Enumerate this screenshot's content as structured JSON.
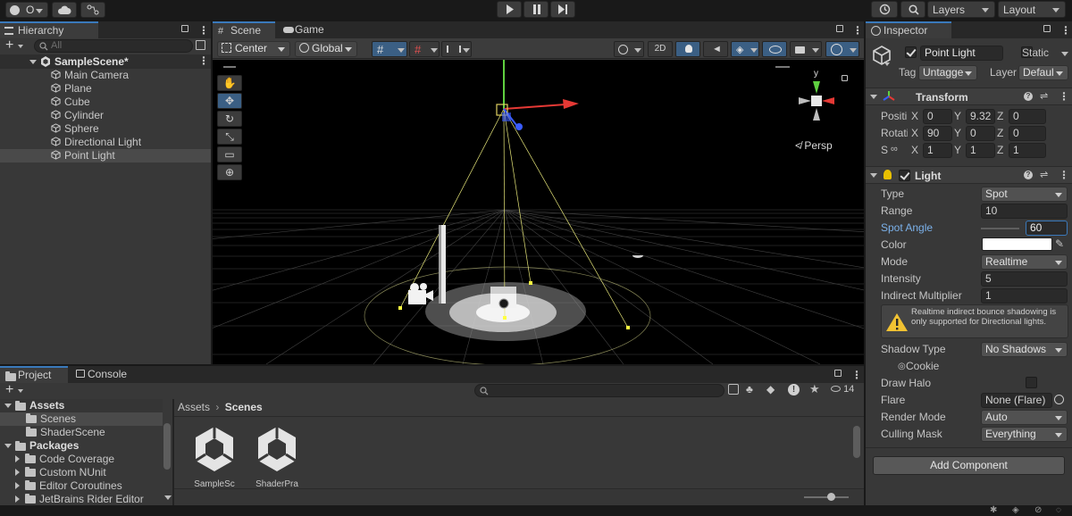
{
  "toolbar": {
    "account_label": "O",
    "layers_label": "Layers",
    "layout_label": "Layout"
  },
  "hierarchy": {
    "tab_label": "Hierarchy",
    "search_placeholder": "All",
    "scene_name": "SampleScene*",
    "items": [
      {
        "label": "Main Camera"
      },
      {
        "label": "Plane"
      },
      {
        "label": "Cube"
      },
      {
        "label": "Cylinder"
      },
      {
        "label": "Sphere"
      },
      {
        "label": "Directional Light"
      },
      {
        "label": "Point Light"
      }
    ]
  },
  "scene_view": {
    "tabs": [
      {
        "label": "Scene"
      },
      {
        "label": "Game"
      }
    ],
    "pivot_label": "Center",
    "space_label": "Global",
    "mode_2d_label": "2D",
    "gizmo_y_label": "y",
    "persp_label": "Persp"
  },
  "project": {
    "tabs": [
      {
        "label": "Project"
      },
      {
        "label": "Console"
      }
    ],
    "hidden_count": "14",
    "tree": {
      "assets_label": "Assets",
      "assets_children": [
        {
          "label": "Scenes"
        },
        {
          "label": "ShaderScene"
        }
      ],
      "packages_label": "Packages",
      "packages_children": [
        {
          "label": "Code Coverage"
        },
        {
          "label": "Custom NUnit"
        },
        {
          "label": "Editor Coroutines"
        },
        {
          "label": "JetBrains Rider Editor"
        }
      ]
    },
    "breadcrumb": {
      "root": "Assets",
      "current": "Scenes"
    },
    "files": [
      {
        "label": "SampleSc"
      },
      {
        "label": "ShaderPra"
      }
    ]
  },
  "inspector": {
    "tab_label": "Inspector",
    "object_name": "Point Light",
    "static_label": "Static",
    "tag_label": "Tag",
    "tag_value": "Untagge",
    "layer_label": "Layer",
    "layer_value": "Defaul",
    "transform": {
      "title": "Transform",
      "position_label": "Positi",
      "rotation_label": "Rotati",
      "scale_label": "S",
      "axis_x": "X",
      "axis_y": "Y",
      "axis_z": "Z",
      "position": {
        "x": "0",
        "y": "9.32",
        "z": "0"
      },
      "rotation": {
        "x": "90",
        "y": "0",
        "z": "0"
      },
      "scale": {
        "x": "1",
        "y": "1",
        "z": "1"
      }
    },
    "light": {
      "title": "Light",
      "type_label": "Type",
      "type_value": "Spot",
      "range_label": "Range",
      "range_value": "10",
      "spot_angle_label": "Spot Angle",
      "spot_angle_value": "60",
      "color_label": "Color",
      "color_value": "#ffffff",
      "mode_label": "Mode",
      "mode_value": "Realtime",
      "intensity_label": "Intensity",
      "intensity_value": "5",
      "indirect_label": "Indirect Multiplier",
      "indirect_value": "1",
      "warning_text": "Realtime indirect bounce shadowing is only supported for Directional lights.",
      "shadow_type_label": "Shadow Type",
      "shadow_type_value": "No Shadows",
      "cookie_label": "Cookie",
      "draw_halo_label": "Draw Halo",
      "flare_label": "Flare",
      "flare_value": "None (Flare)",
      "render_mode_label": "Render Mode",
      "render_mode_value": "Auto",
      "culling_mask_label": "Culling Mask",
      "culling_mask_value": "Everything"
    },
    "add_component_label": "Add Component"
  },
  "colors": {
    "accent": "#3a79bb",
    "selection": "#2c5d87",
    "panel": "#383838",
    "axis_x": "#e53935",
    "axis_y": "#5fd040",
    "axis_z": "#3a5cff"
  }
}
